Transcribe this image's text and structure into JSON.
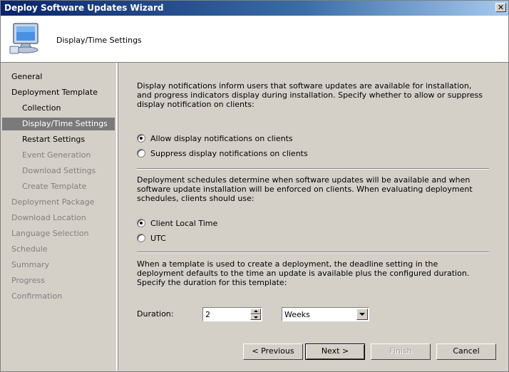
{
  "window": {
    "title": "Deploy Software Updates Wizard",
    "close_label": "✕"
  },
  "header": {
    "page_title": "Display/Time Settings",
    "icon": "computer-monitor-icon"
  },
  "sidebar": {
    "items": [
      {
        "label": "General",
        "state": "normal"
      },
      {
        "label": "Deployment Template",
        "state": "normal"
      },
      {
        "label": "Collection",
        "state": "normal"
      },
      {
        "label": "Display/Time Settings",
        "state": "selected"
      },
      {
        "label": "Restart Settings",
        "state": "normal"
      },
      {
        "label": "Event Generation",
        "state": "disabled"
      },
      {
        "label": "Download Settings",
        "state": "disabled"
      },
      {
        "label": "Create Template",
        "state": "disabled"
      },
      {
        "label": "Deployment Package",
        "state": "disabled"
      },
      {
        "label": "Download Location",
        "state": "disabled"
      },
      {
        "label": "Language Selection",
        "state": "disabled"
      },
      {
        "label": "Schedule",
        "state": "disabled"
      },
      {
        "label": "Summary",
        "state": "disabled"
      },
      {
        "label": "Progress",
        "state": "disabled"
      },
      {
        "label": "Confirmation",
        "state": "disabled"
      }
    ]
  },
  "main": {
    "display_intro": "Display notifications inform users that software updates are available for installation, and progress indicators display during installation. Specify whether to allow or suppress display notification on clients:",
    "display_options": [
      {
        "label": "Allow display notifications on clients",
        "checked": true
      },
      {
        "label": "Suppress display notifications on clients",
        "checked": false
      }
    ],
    "schedule_intro": "Deployment schedules determine when software updates will be available and when software update installation will be enforced on clients. When evaluating deployment schedules, clients should use:",
    "time_options": [
      {
        "label": "Client Local Time",
        "checked": true
      },
      {
        "label": "UTC",
        "checked": false
      }
    ],
    "duration_intro": "When a template is used to create a deployment, the deadline setting in the deployment defaults to the time an update is available plus the configured duration. Specify the duration for this template:",
    "duration_label": "Duration:",
    "duration_value": "2",
    "duration_unit": "Weeks"
  },
  "buttons": {
    "previous": "< Previous",
    "next": "Next >",
    "finish": "Finish",
    "cancel": "Cancel"
  }
}
